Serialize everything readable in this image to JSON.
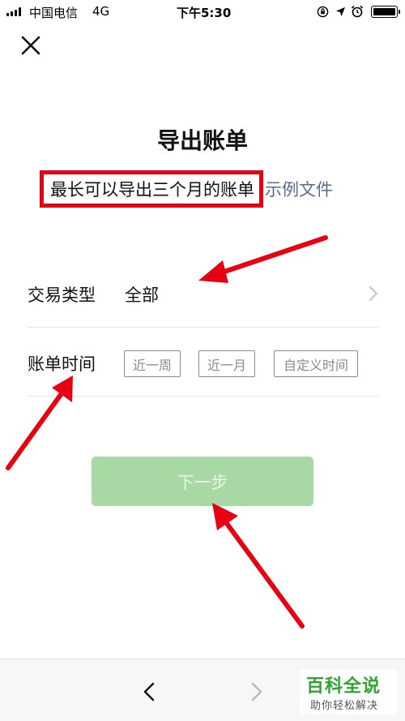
{
  "status_bar": {
    "carrier": "中国电信",
    "network": "4G",
    "time": "下午5:30",
    "icons": [
      "signal-bars-icon",
      "rotation-lock-icon",
      "location-arrow-icon",
      "alarm-icon",
      "battery-icon"
    ]
  },
  "header": {
    "close_icon": "close-icon",
    "title": "导出账单"
  },
  "subtitle": {
    "text": "最长可以导出三个月的账单",
    "link": "示例文件"
  },
  "form": {
    "type_row": {
      "label": "交易类型",
      "value": "全部"
    },
    "time_row": {
      "label": "账单时间",
      "options": [
        "近一周",
        "近一月",
        "自定义时间"
      ]
    }
  },
  "next_button": {
    "label": "下一步"
  },
  "bottom_nav": {
    "back_icon": "chevron-left-icon",
    "forward_icon": "chevron-right-icon"
  },
  "watermark": {
    "title": "百科全说",
    "subtitle": "助你轻松解决"
  },
  "colors": {
    "highlight_border": "#e60012",
    "link": "#576b95",
    "next_button_bg": "#a8d8a3",
    "next_button_text": "#e8f6e6",
    "arrow": "#e60012",
    "watermark_green": "#2fa52f"
  }
}
